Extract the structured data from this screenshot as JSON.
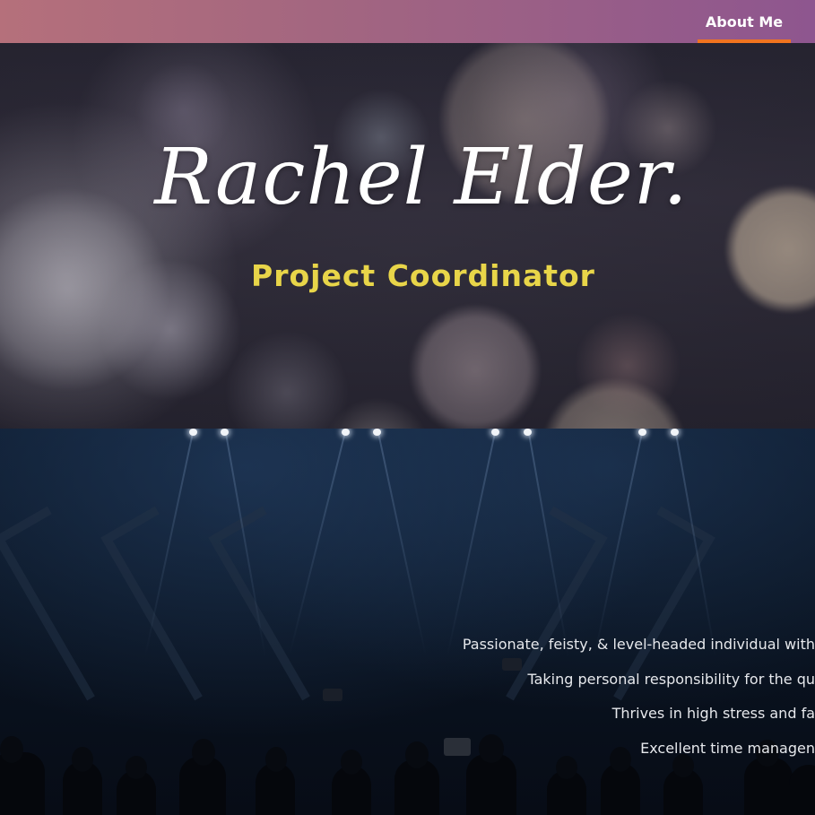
{
  "nav": {
    "items": [
      {
        "label": "About Me",
        "active": true
      }
    ],
    "active_underline_color": "#f0731f",
    "gradient": [
      "#b5707b",
      "#8e568f"
    ]
  },
  "hero": {
    "name": "Rachel Elder.",
    "title": "Project Coordinator",
    "title_color": "#e8d549",
    "background": "bokeh lights"
  },
  "about": {
    "background": "concert crowd with stage lights",
    "lines": [
      "Passionate, feisty, & level-headed individual with",
      "Taking personal responsibility for the qu",
      "Thrives in high stress and fa",
      "Excellent time managen"
    ]
  }
}
